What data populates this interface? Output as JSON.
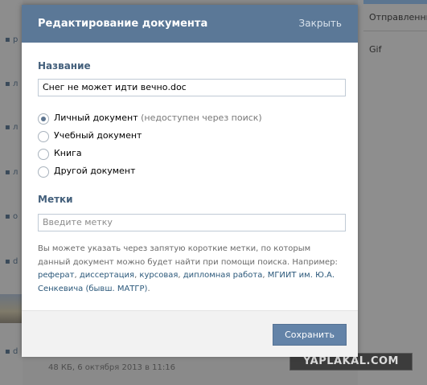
{
  "background": {
    "right_items": [
      "Отправленны",
      "Gif"
    ],
    "bottom_meta": "48 КБ, 6 октября 2013 в 11:16",
    "watermark": "YAPLAKAL.COM"
  },
  "modal": {
    "title": "Редактирование документа",
    "close_label": "Закрыть",
    "name_section": {
      "label": "Название",
      "value": "Снег не может идти вечно.doc"
    },
    "doc_types": [
      {
        "label": "Личный документ",
        "note": " (недоступен через поиск)",
        "checked": true
      },
      {
        "label": "Учебный документ",
        "note": "",
        "checked": false
      },
      {
        "label": "Книга",
        "note": "",
        "checked": false
      },
      {
        "label": "Другой документ",
        "note": "",
        "checked": false
      }
    ],
    "tags_section": {
      "label": "Метки",
      "placeholder": "Введите метку"
    },
    "hint": {
      "text": "Вы можете указать через запятую короткие метки, по которым данный документ можно будет найти при помощи поиска. Например: ",
      "examples": [
        "реферат",
        "диссертация",
        "курсовая",
        "дипломная работа",
        "МГИИТ им. Ю.А. Сенкевича (бывш. МАТГР)"
      ],
      "end": "."
    },
    "save_label": "Сохранить"
  }
}
